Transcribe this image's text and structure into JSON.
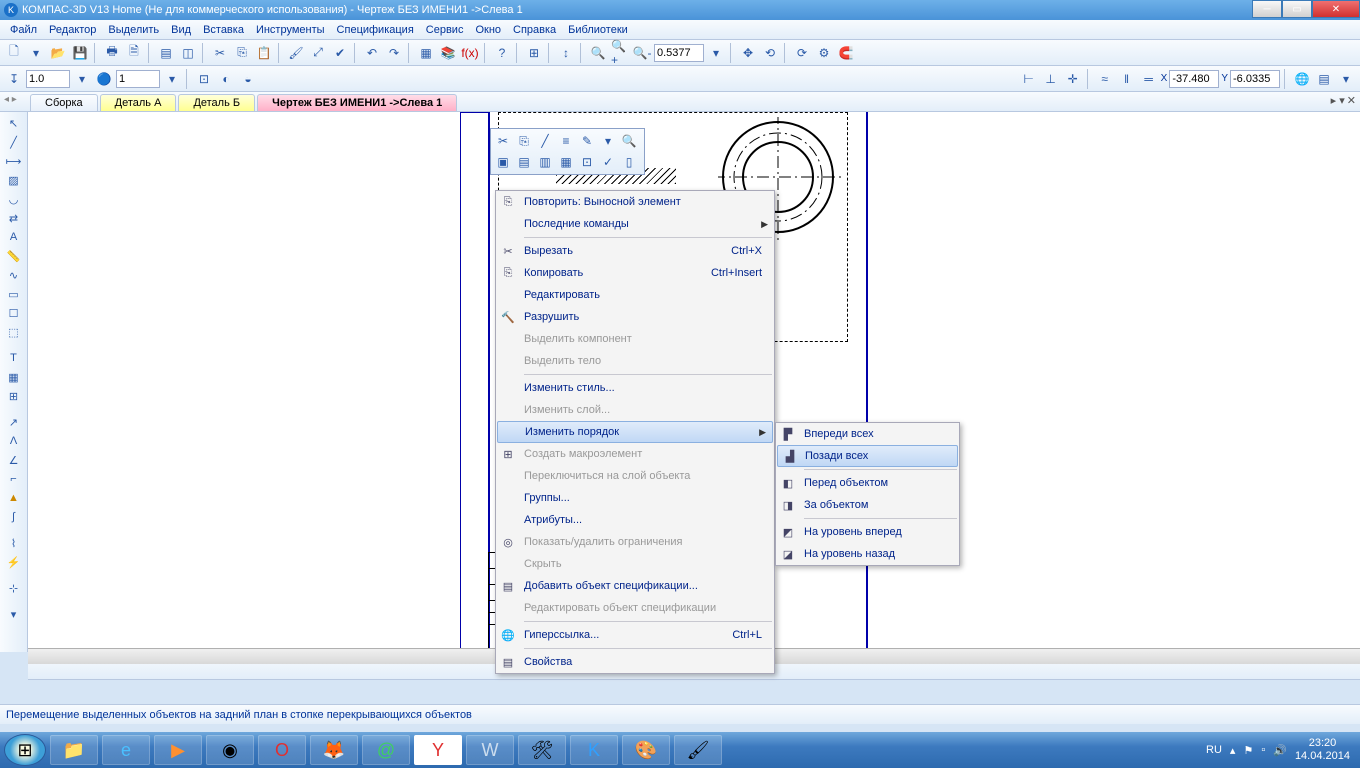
{
  "title": "КОМПАС-3D V13 Home (Не для коммерческого использования) - Чертеж БЕЗ ИМЕНИ1 ->Слева 1",
  "menu": [
    "Файл",
    "Редактор",
    "Выделить",
    "Вид",
    "Вставка",
    "Инструменты",
    "Спецификация",
    "Сервис",
    "Окно",
    "Справка",
    "Библиотеки"
  ],
  "toolbar2": {
    "zoom": "0.5377",
    "coord_x": "-37.480",
    "coord_y": "-6.0335",
    "field1": "1.0",
    "field2": "1"
  },
  "tabs": [
    "Сборка",
    "Деталь А",
    "Деталь Б",
    "Чертеж БЕЗ ИМЕНИ1 ->Слева 1"
  ],
  "ctx": {
    "repeat": "Повторить: Выносной элемент",
    "recent": "Последние команды",
    "cut": "Вырезать",
    "cut_sc": "Ctrl+X",
    "copy": "Копировать",
    "copy_sc": "Ctrl+Insert",
    "edit": "Редактировать",
    "destroy": "Разрушить",
    "sel_comp": "Выделить компонент",
    "sel_body": "Выделить тело",
    "ch_style": "Изменить стиль...",
    "ch_layer": "Изменить слой...",
    "ch_order": "Изменить порядок",
    "make_macro": "Создать макроэлемент",
    "switch_layer": "Переключиться на слой объекта",
    "groups": "Группы...",
    "attrs": "Атрибуты...",
    "constraints": "Показать/удалить ограничения",
    "hide": "Скрыть",
    "add_spec": "Добавить объект спецификации...",
    "edit_spec": "Редактировать объект спецификации",
    "hyper": "Гиперссылка...",
    "hyper_sc": "Ctrl+L",
    "props": "Свойства"
  },
  "sub": {
    "front_all": "Впереди всех",
    "back_all": "Позади всех",
    "before_obj": "Перед объектом",
    "after_obj": "За объектом",
    "level_fwd": "На уровень вперед",
    "level_back": "На уровень назад"
  },
  "status": "Перемещение выделенных объектов на задний план в стопке перекрывающихся объектов",
  "tray": {
    "lang": "RU",
    "time": "23:20",
    "date": "14.04.2014"
  }
}
